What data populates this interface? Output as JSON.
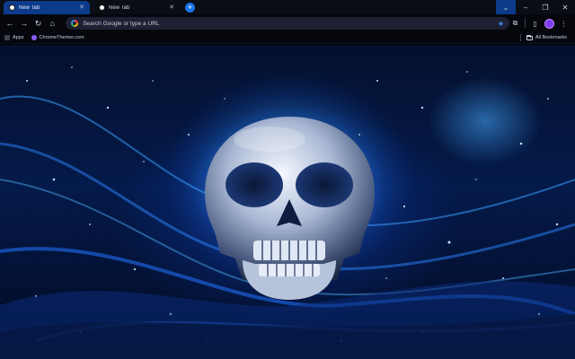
{
  "tabs": [
    {
      "title": "New Tab",
      "active": true
    },
    {
      "title": "New Tab",
      "active": false
    }
  ],
  "toolbar": {
    "omnibox_placeholder": "Search Google or type a URL"
  },
  "bookmarks": {
    "apps_label": "Apps",
    "items": [
      {
        "label": "ChromeThemer.com"
      }
    ],
    "all_bookmarks_label": "All Bookmarks"
  },
  "theme": {
    "accent": "#1a73e8",
    "tab_active": "#0b3b8a",
    "frame": "#0a0d14",
    "wallpaper_subject": "glowing skull in blue particle waves"
  }
}
